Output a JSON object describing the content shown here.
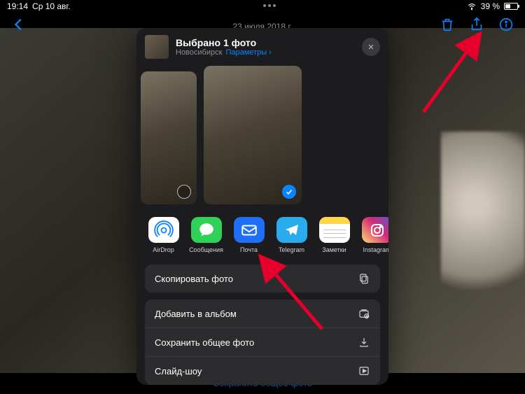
{
  "status": {
    "time": "19:14",
    "date": "Ср 10 авг.",
    "battery_pct": "39 %"
  },
  "nav": {
    "photo_date": "23 июля 2018 г."
  },
  "bottom_action": "Сохранить общее фото",
  "sheet": {
    "title": "Выбрано 1 фото",
    "location": "Новосибирск",
    "params_label": "Параметры",
    "apps": [
      {
        "label": "AirDrop",
        "class": "ic-airdrop"
      },
      {
        "label": "Сообщения",
        "class": "ic-messages"
      },
      {
        "label": "Почта",
        "class": "ic-mail"
      },
      {
        "label": "Telegram",
        "class": "ic-telegram"
      },
      {
        "label": "Заметки",
        "class": "ic-notes"
      },
      {
        "label": "Instagram",
        "class": "ic-instagram"
      }
    ],
    "actions_single": "Скопировать фото",
    "actions_group": [
      "Добавить в альбом",
      "Сохранить общее фото",
      "Слайд-шоу"
    ]
  }
}
